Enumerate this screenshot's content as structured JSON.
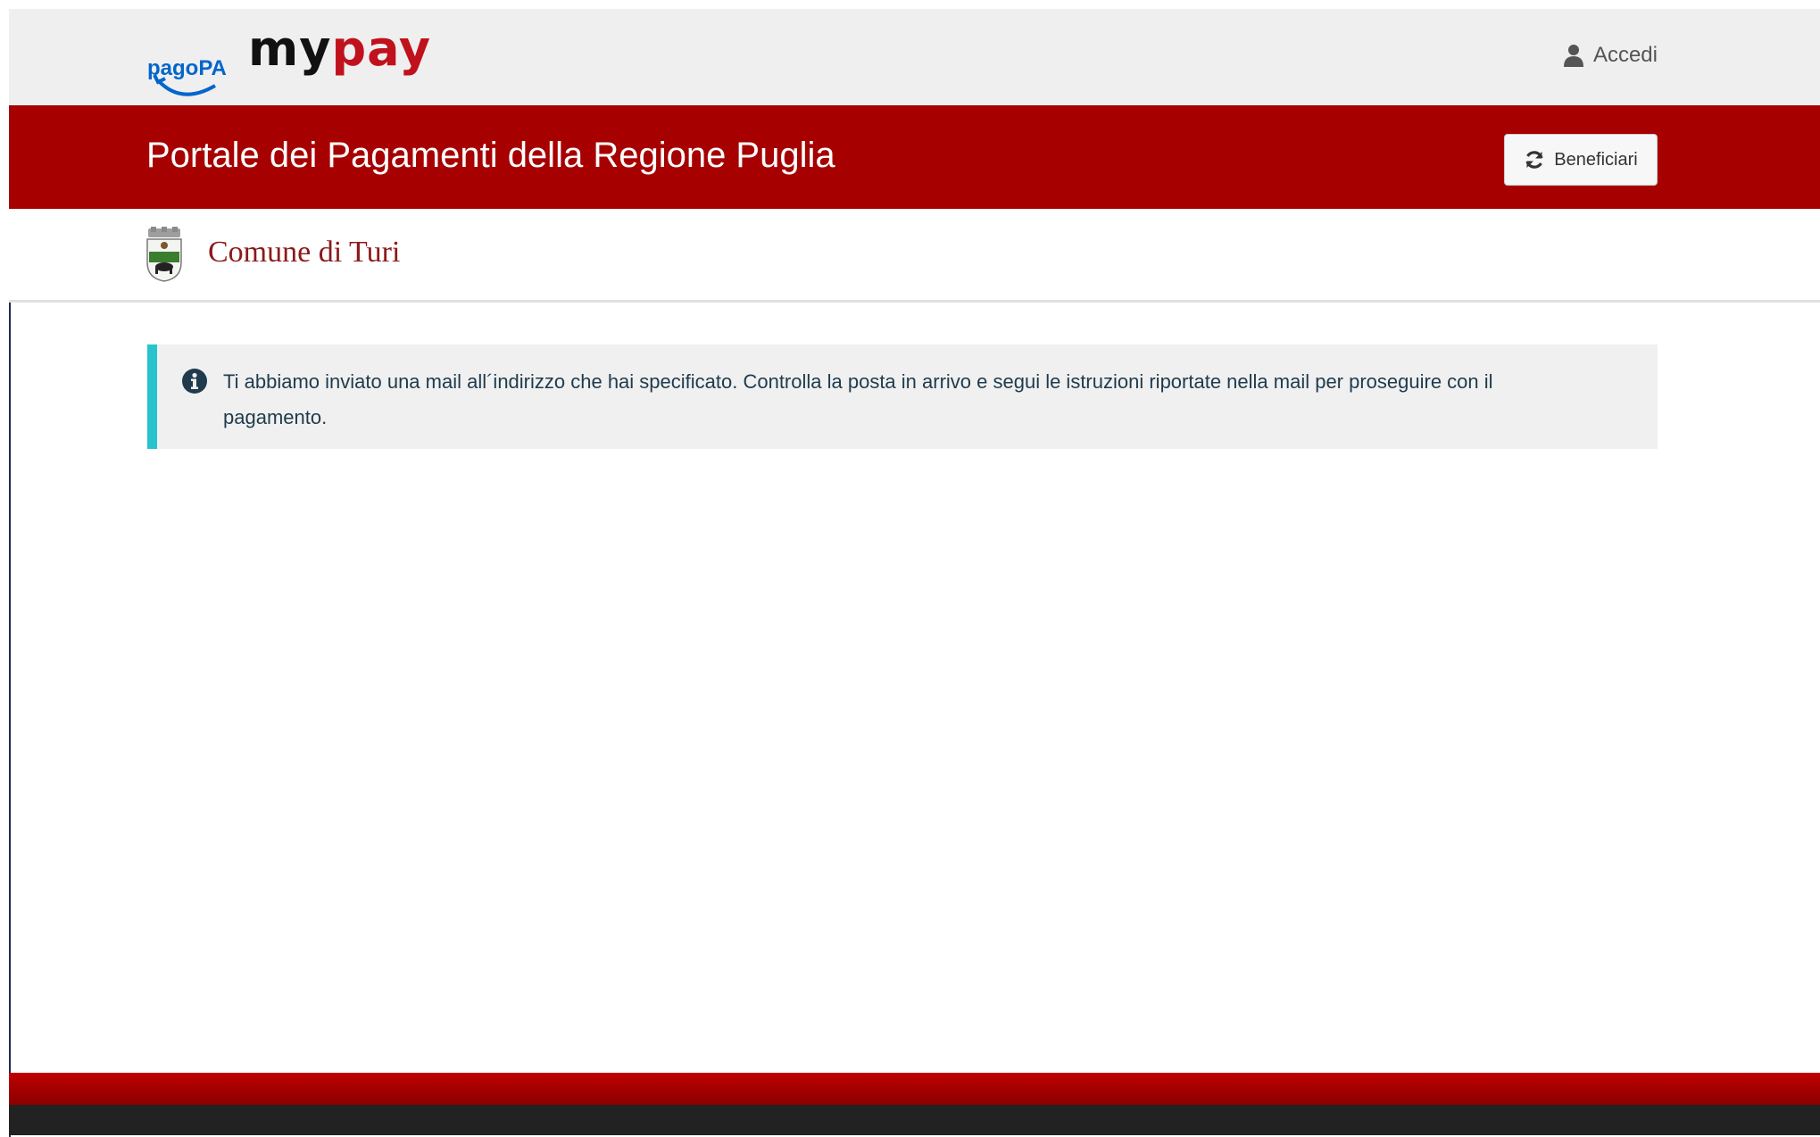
{
  "header": {
    "logo_pagopa_label": "pagoPA",
    "logo_my": "my",
    "logo_pay": "pay",
    "login_label": "Accedi"
  },
  "banner": {
    "title": "Portale dei Pagamenti della Regione Puglia",
    "beneficiari_label": "Beneficiari"
  },
  "entity": {
    "name": "Comune di Turi"
  },
  "alert": {
    "message": "Ti abbiamo inviato una mail all´indirizzo che hai specificato. Controlla la posta in arrivo e segui le istruzioni riportate nella mail per proseguire con il pagamento."
  },
  "colors": {
    "brand_red": "#a60000",
    "alert_accent": "#28c3cc",
    "entity_text": "#8b1a1a",
    "pagopa_blue": "#0066cc"
  },
  "icons": {
    "login": "user-icon",
    "beneficiari": "refresh-icon",
    "alert": "info-circle-icon"
  }
}
